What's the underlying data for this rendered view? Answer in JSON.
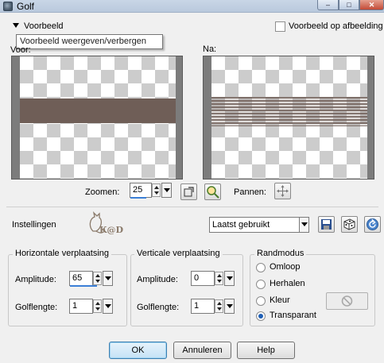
{
  "window": {
    "title": "Golf",
    "minimize_glyph": "–",
    "maximize_glyph": "□",
    "close_glyph": "✕"
  },
  "preview": {
    "toggle_label": "Voorbeeld",
    "tooltip": "Voorbeeld weergeven/verbergen",
    "on_image_label": "Voorbeeld op afbeelding",
    "before_label": "Voor:",
    "after_label": "Na:"
  },
  "zoom": {
    "label": "Zoomen:",
    "value": "25",
    "pan_label": "Pannen:"
  },
  "settings": {
    "label": "Instellingen",
    "preset_value": "Laatst gebruikt",
    "logo_text": "K@D"
  },
  "horizontal": {
    "title": "Horizontale verplaatsing",
    "amplitude_label": "Amplitude:",
    "amplitude_value": "65",
    "wavelength_label": "Golflengte:",
    "wavelength_value": "1"
  },
  "vertical": {
    "title": "Verticale verplaatsing",
    "amplitude_label": "Amplitude:",
    "amplitude_value": "0",
    "wavelength_label": "Golflengte:",
    "wavelength_value": "1"
  },
  "edge_mode": {
    "title": "Randmodus",
    "options": [
      "Omloop",
      "Herhalen",
      "Kleur",
      "Transparant"
    ],
    "selected": "Transparant"
  },
  "buttons": {
    "ok": "OK",
    "cancel": "Annuleren",
    "help": "Help"
  },
  "colors": {
    "band": "#6f5e57",
    "accent": "#3b7fd6"
  }
}
